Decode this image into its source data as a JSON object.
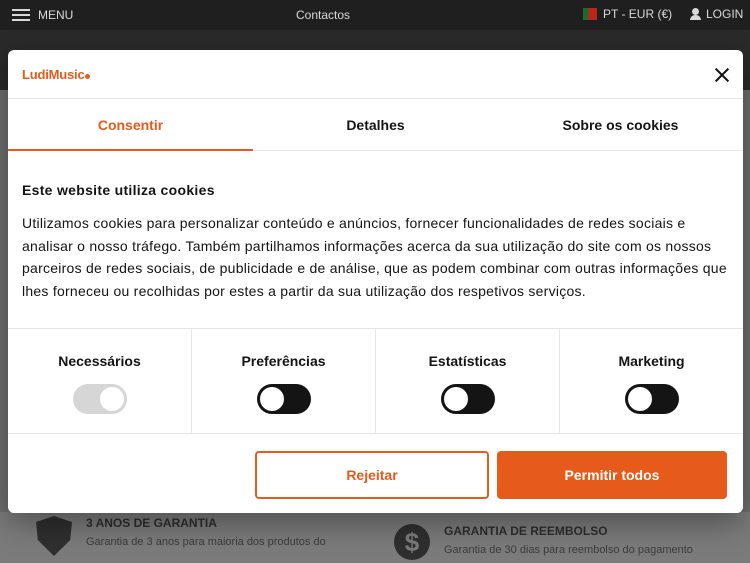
{
  "topbar": {
    "menu_label": "MENU",
    "contacts_label": "Contactos",
    "language_currency": "PT - EUR (€)",
    "login_label": "LOGIN"
  },
  "features": [
    {
      "icon": "shield-check-icon",
      "title": "3 ANOS DE GARANTIA",
      "subtitle": "Garantia de 3 anos para maioria dos produtos do"
    },
    {
      "icon": "dollar-icon",
      "title": "GARANTIA DE REEMBOLSO",
      "subtitle": "Garantia de 30 dias para reembolso do pagamento"
    }
  ],
  "consent": {
    "logo_text": "LudiMusic",
    "tabs": [
      {
        "label": "Consentir",
        "active": true
      },
      {
        "label": "Detalhes",
        "active": false
      },
      {
        "label": "Sobre os cookies",
        "active": false
      }
    ],
    "heading": "Este website utiliza cookies",
    "body": "Utilizamos cookies para personalizar conteúdo e anúncios, fornecer funcionalidades de redes sociais e analisar o nosso tráfego. Também partilhamos informações acerca da sua utilização do site com os nossos parceiros de redes sociais, de publicidade e de análise, que as podem combinar com outras informações que lhes forneceu ou recolhidas por estes a partir da sua utilização dos respetivos serviços.",
    "categories": [
      {
        "label": "Necessários",
        "enabled": true,
        "locked": true
      },
      {
        "label": "Preferências",
        "enabled": false,
        "locked": false
      },
      {
        "label": "Estatísticas",
        "enabled": false,
        "locked": false
      },
      {
        "label": "Marketing",
        "enabled": false,
        "locked": false
      }
    ],
    "reject_label": "Rejeitar",
    "allow_all_label": "Permitir todos"
  },
  "colors": {
    "accent": "#e65a1b",
    "toggle_off": "#141414",
    "toggle_locked": "#d6d6d6"
  }
}
